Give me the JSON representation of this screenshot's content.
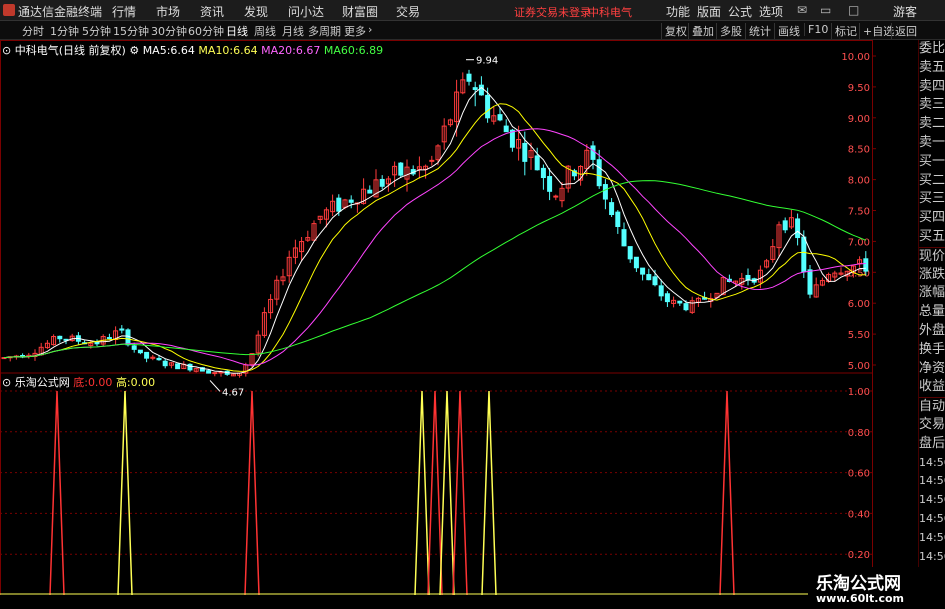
{
  "app": {
    "title": "通达信金融终端"
  },
  "menu": {
    "items": [
      "行情",
      "市场",
      "资讯",
      "发现",
      "问小达",
      "财富圈",
      "交易"
    ],
    "warning": "证券交易未登录",
    "stock_name": "中科电气",
    "right_items": [
      "功能",
      "版面",
      "公式",
      "选项"
    ],
    "guest": "游客"
  },
  "toolbar": {
    "periods": [
      "分时",
      "1分钟",
      "5分钟",
      "15分钟",
      "30分钟",
      "60分钟",
      "日线",
      "周线",
      "月线",
      "多周期",
      "更多"
    ],
    "active_period": "日线",
    "right_buttons": [
      "复权",
      "叠加",
      "多股",
      "统计",
      "画线",
      "F10",
      "标记",
      "+自选",
      "返回"
    ]
  },
  "main_chart": {
    "title": "中科电气(日线 前复权)",
    "ma": [
      {
        "label": "MA5:",
        "value": "6.64",
        "color": "#ffffff"
      },
      {
        "label": "MA10:",
        "value": "6.64",
        "color": "#ffff00"
      },
      {
        "label": "MA20:",
        "value": "6.67",
        "color": "#ff44ff"
      },
      {
        "label": "MA60:",
        "value": "6.89",
        "color": "#33ff33"
      }
    ],
    "y_ticks": [
      "10.00",
      "9.50",
      "9.00",
      "8.50",
      "8.00",
      "7.50",
      "7.00",
      "6.50",
      "6.00",
      "5.50",
      "5.00"
    ],
    "high_label": "9.94",
    "low_label": "4.67"
  },
  "indicator": {
    "name": "乐淘公式网",
    "low_label": "底:",
    "low_value": "0.00",
    "high_label": "高:",
    "high_value": "0.00",
    "y_ticks": [
      "1.00",
      "0.80",
      "0.60",
      "0.40",
      "0.20"
    ]
  },
  "x_axis": {
    "labels": [
      "2019年",
      "11",
      "12",
      "1",
      "2",
      "3",
      "4"
    ]
  },
  "quote_panel": {
    "items": [
      "委比",
      "卖五",
      "卖四",
      "卖三",
      "卖二",
      "卖一",
      "买一",
      "买二",
      "买三",
      "买四",
      "买五",
      "现价",
      "涨跌",
      "涨幅",
      "总量",
      "外盘",
      "换手",
      "净资",
      "收益",
      "自动",
      "交易",
      "盘后",
      "14:56",
      "14:56",
      "14:56",
      "14:56",
      "14:56",
      "14:56",
      "14:56",
      "14:56"
    ]
  },
  "watermark": {
    "line1": "乐淘公式网",
    "line2": "www.60lt.com"
  },
  "colors": {
    "up": "#ff3c3c",
    "down": "#54ffff",
    "ma5": "#ffffff",
    "ma10": "#ffff00",
    "ma20": "#ff44ff",
    "ma60": "#33ff33",
    "grid": "#7a0000"
  },
  "chart_data": [
    {
      "type": "candlestick",
      "title": "中科电气(日线 前复权)",
      "ylim": [
        4.5,
        10.2
      ],
      "series": [
        {
          "name": "MA5",
          "value": 6.64
        },
        {
          "name": "MA10",
          "value": 6.64
        },
        {
          "name": "MA20",
          "value": 6.67
        },
        {
          "name": "MA60",
          "value": 6.89
        }
      ],
      "annotations": [
        {
          "label": "9.94"
        },
        {
          "label": "4.67"
        }
      ]
    },
    {
      "type": "line",
      "title": "乐淘公式网",
      "ylim": [
        0,
        1.0
      ],
      "series": [
        {
          "name": "底",
          "values": [
            0,
            1,
            0,
            0,
            1,
            0,
            0,
            1,
            0,
            1,
            0,
            1,
            0,
            0,
            1
          ]
        },
        {
          "name": "高",
          "values": [
            0,
            0,
            1,
            0,
            0,
            1,
            0,
            0,
            1,
            0,
            1,
            0,
            1,
            0,
            0
          ]
        }
      ]
    }
  ]
}
